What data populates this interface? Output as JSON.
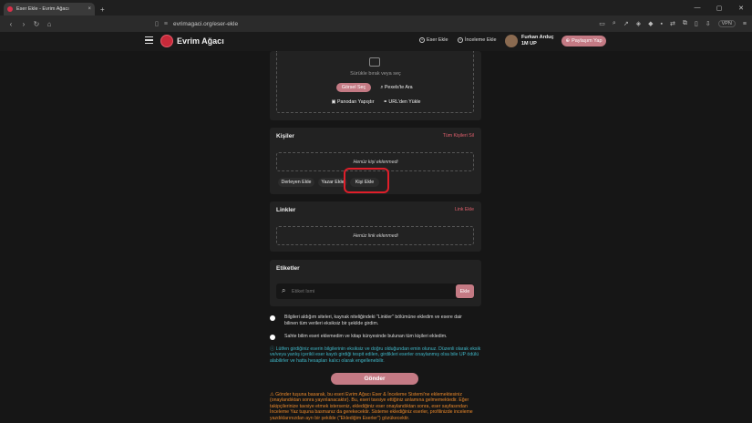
{
  "browser": {
    "tab_title": "Eser Ekle - Evrim Ağacı",
    "tab_close": "×",
    "new_tab": "+",
    "url": "evrimagaci.org/eser-ekle",
    "vpn": "VPN",
    "win_min": "—",
    "win_max": "▢",
    "win_close": "✕"
  },
  "header": {
    "brand": "Evrim Ağacı",
    "add_work": "Eser Ekle",
    "review_add": "İnceleme Ekle",
    "user_name": "Furkan Arduç",
    "user_sub": "1M UP",
    "share": "Paylaşım Yap"
  },
  "upload": {
    "drag_text": "Sürükle bırak veya seç",
    "select_image": "Görsel Seç",
    "pexels": "Pexels'te Ara",
    "paste": "Panodan Yapıştır",
    "url_load": "URL'den Yükle"
  },
  "people": {
    "title": "Kişiler",
    "clear_all": "Tüm Kişileri Sil",
    "empty": "Henüz kişi eklenmedi",
    "add_compiler": "Derleyen Ekle",
    "add_author": "Yazar Ekle",
    "add_person": "Kişi Ekle"
  },
  "links": {
    "title": "Linkler",
    "add_link": "Link Ekle",
    "empty": "Henüz link eklenmedi"
  },
  "tags": {
    "title": "Etiketler",
    "placeholder": "Etiket İsmi",
    "add": "Ekle"
  },
  "checks": {
    "first": "Bilgileri aldığım siteleri, kaynak niteliğindeki \"Linkler\" bölümüne ekledim ve esere dair bilinen tüm verileri eksiksiz bir şekilde girdim.",
    "second": "Sahte bilim eseri eklemedim ve kitap künyesinde bulunan tüm kişileri ekledim."
  },
  "info": "Lütfen girdiğiniz eserin bilgilerinin eksiksiz ve doğru olduğundan emin olunuz. Düzenli olarak eksik ve/veya yanlış içerikli eser kaydı girdiği tespit edilen, girdikleri eserler onaylanmış olsa bile UP ödülü alabilirler ve hatta hesapları kalıcı olarak engellenebilir.",
  "submit": "Gönder",
  "warning": "Gönder tuşuna basarak, bu eseri Evrim Ağacı Eser & İnceleme Sistemi'ne eklemektesiniz (onaylandıktan sonra yayınlanacaktır). Bu, eseri tavsiye ettiğiniz anlamına gelmemektedir. Eğer takipçilerinize tavsiye etmek isterseniz, eklediğiniz eser onaylandıktan sonra, eser sayfasından İnceleme Yaz tuşuna basmanız da gerekecektir. Sisteme eklediğiniz eserler, profilinizde inceleme yazdıklarınızdan ayrı bir şekilde (\"Eklediğim Eserler\") gözükecektir."
}
